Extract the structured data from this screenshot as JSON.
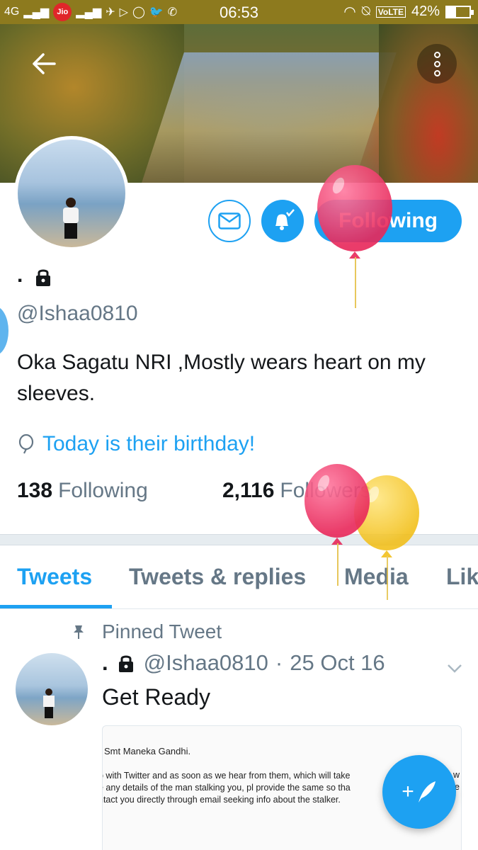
{
  "status_bar": {
    "carrier": "Jio",
    "network": "4G",
    "time": "06:53",
    "volte": "VoLTE",
    "battery": "42%",
    "battery_level": 0.42
  },
  "header": {
    "back_icon": "back-arrow-icon",
    "more_icon": "more-vertical-icon"
  },
  "profile": {
    "display_name": ".",
    "protected_icon": "lock-icon",
    "handle": "@Ishaa0810",
    "bio": "Oka Sagatu NRI ,Mostly wears heart on my sleeves.",
    "birthday_text": "Today is their birthday!",
    "following_count": "138",
    "following_label": "Following",
    "followers_count": "2,116",
    "followers_label": "Followers"
  },
  "actions": {
    "message_icon": "envelope-icon",
    "notifications_icon": "bell-check-icon",
    "follow_state_label": "Following"
  },
  "tabs": [
    {
      "label": "Tweets",
      "active": true
    },
    {
      "label": "Tweets & replies",
      "active": false
    },
    {
      "label": "Media",
      "active": false
    },
    {
      "label": "Lik",
      "active": false
    }
  ],
  "pinned_tweet": {
    "pinned_label": "Pinned Tweet",
    "display_name": ".",
    "handle": "@Ishaa0810",
    "separator": "·",
    "date": "25 Oct 16",
    "text": "Get Ready",
    "media_line1": "Smt Maneka Gandhi.",
    "media_line2": "p with Twitter and as soon as we hear from them, which will take",
    "media_line3": "e any details of the man stalking you, pl provide the same so tha",
    "media_line4": "ntact you directly through email seeking info about the stalker.",
    "media_edge_right_1": "w",
    "media_edge_right_2": "e"
  },
  "fab": {
    "label": "+",
    "icon": "compose-feather-icon"
  },
  "colors": {
    "accent": "#1da1f2",
    "status_bar": "#8d7a1e",
    "balloon_pink": "#f03b6a",
    "balloon_yellow": "#f5c518"
  }
}
